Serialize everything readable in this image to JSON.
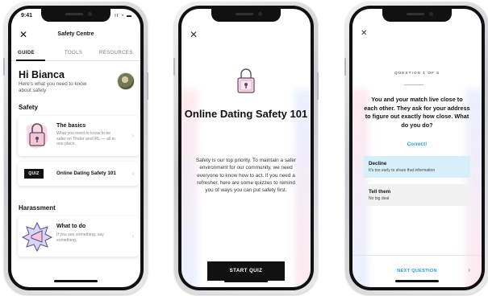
{
  "phone1": {
    "status_time": "9:41",
    "status_icons": "∷ ◔ ▬",
    "close_glyph": "✕",
    "title": "Safety Centre",
    "tabs": [
      "GUIDE",
      "TOOLS",
      "RESOURCES"
    ],
    "greeting": "Hi Bianca",
    "subtitle": "Here's what you need to know about safety",
    "sections": {
      "safety": "Safety",
      "harassment": "Harassment"
    },
    "cards": {
      "basics": {
        "title": "The basics",
        "desc": "What you need to know to be safer on Tinder and IRL — all in one place."
      },
      "quiz": {
        "badge": "QUIZ",
        "title": "Online Dating Safety 101"
      },
      "todo": {
        "title": "What to do",
        "desc": "If you see something, say something."
      }
    },
    "chevron": "›"
  },
  "phone2": {
    "close_glyph": "✕",
    "title": "Online Dating Safety 101",
    "body": "Safety is our top priority. To maintain a safer environment for our community, we need everyone to know how to act. If you need a refresher, here are some quizzes to remind you of ways you can put safety first.",
    "button": "START QUIZ"
  },
  "phone3": {
    "close_glyph": "✕",
    "question_number": "QUESTION 1 OF 6",
    "question": "You and your match live close to each other. They ask for your address to figure out exactly how close. What do you do?",
    "feedback": "Correct!",
    "options": [
      {
        "title": "Decline",
        "desc": "It's too early to share that information"
      },
      {
        "title": "Tell them",
        "desc": "No big deal"
      }
    ],
    "next": "NEXT QUESTION",
    "next_chevron": "›"
  },
  "colors": {
    "accent": "#1e9ee3",
    "selected_option": "#d7eefb",
    "badge_bg": "#111111"
  }
}
